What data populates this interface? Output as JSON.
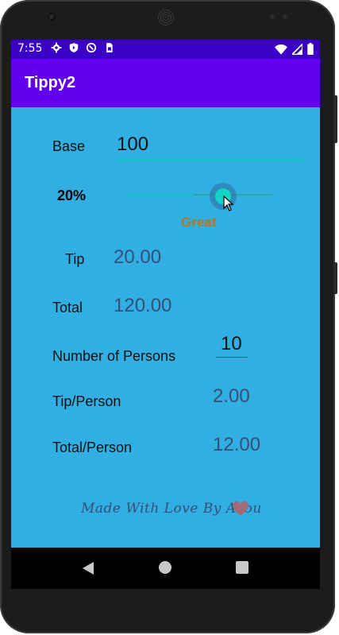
{
  "status_bar": {
    "time": "7:55",
    "left_icons": [
      "settings-icon",
      "shield-icon",
      "sync-icon",
      "sim-card-icon"
    ],
    "right_icons": [
      "wifi-icon",
      "signal-icon",
      "battery-icon"
    ]
  },
  "app": {
    "title": "Tippy2"
  },
  "form": {
    "base_label": "Base",
    "base_value": "100",
    "tip_percent_label": "20%",
    "slider_value_percent": 20,
    "tip_description": "Great",
    "tip_label": "Tip",
    "tip_value": "20.00",
    "total_label": "Total",
    "total_value": "120.00",
    "persons_label": "Number of Persons",
    "persons_value": "10",
    "tip_per_person_label": "Tip/Person",
    "tip_per_person_value": "2.00",
    "total_per_person_label": "Total/Person",
    "total_per_person_value": "12.00"
  },
  "footer": {
    "text": "Made With Love By Axou"
  },
  "colors": {
    "background": "#31aee2",
    "appbar": "#6200ee",
    "statusbar": "#3b00c8",
    "accent": "#11c9c2",
    "tip_description": "#b5761f"
  }
}
